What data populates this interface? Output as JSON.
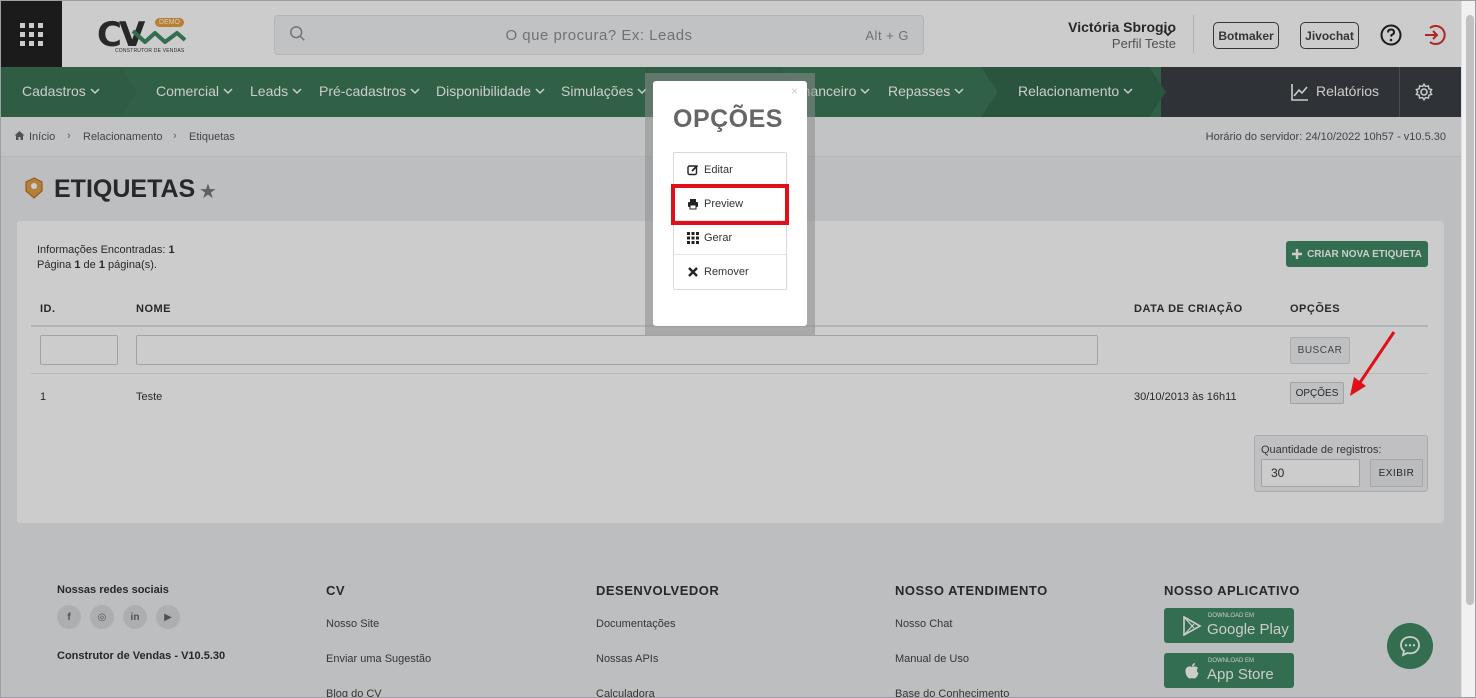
{
  "header": {
    "logo_text": "CV",
    "logo_badge": "DEMO",
    "logo_sub": "CONSTRUTOR DE VENDAS",
    "search_placeholder": "O que procura? Ex: Leads",
    "search_shortcut": "Alt + G",
    "user_name": "Victória Sbrogio",
    "user_profile": "Perfil Teste",
    "btn_botmaker": "Botmaker",
    "btn_jivochat": "Jivochat"
  },
  "nav": {
    "items": [
      "Cadastros",
      "Comercial",
      "Leads",
      "Pré-cadastros",
      "Disponibilidade",
      "Simulações",
      "Financeiro",
      "Repasses",
      "Relacionamento"
    ],
    "relatorios": "Relatórios",
    "colors": {
      "green": "#3d7a59",
      "dark": "#3b3f44"
    }
  },
  "breadcrumb": {
    "items": [
      "Início",
      "Relacionamento",
      "Etiquetas"
    ],
    "server_time": "Horário do servidor: 24/10/2022 10h57 - v10.5.30"
  },
  "page": {
    "title": "ETIQUETAS",
    "info_label": "Informações Encontradas:",
    "info_count": "1",
    "page_text_1": "Página",
    "page_current": "1",
    "page_text_2": "de",
    "page_total": "1",
    "page_text_3": "página(s).",
    "new_button": "CRIAR NOVA ETIQUETA",
    "columns": [
      "ID.",
      "NOME",
      "DATA DE CRIAÇÃO",
      "OPÇÕES"
    ],
    "search_button": "BUSCAR",
    "rows": [
      {
        "id": "1",
        "name": "Teste",
        "created": "30/10/2013 às 16h11",
        "options": "OPÇÕES"
      }
    ],
    "qty_label": "Quantidade de registros:",
    "qty_value": "30",
    "qty_button": "EXIBIR"
  },
  "footer": {
    "social_title": "Nossas redes sociais",
    "version": "Construtor de Vendas - V10.5.30",
    "cols": [
      {
        "title": "CV",
        "links": [
          "Nosso Site",
          "Enviar uma Sugestão",
          "Blog do CV"
        ]
      },
      {
        "title": "DESENVOLVEDOR",
        "links": [
          "Documentações",
          "Nossas APIs",
          "Calculadora"
        ]
      },
      {
        "title": "NOSSO ATENDIMENTO",
        "links": [
          "Nosso Chat",
          "Manual de Uso",
          "Base do Conhecimento"
        ]
      }
    ],
    "app_title": "NOSSO APLICATIVO",
    "google_small": "DOWNLOAD EM",
    "google_big": "Google Play",
    "apple_small": "DOWNLOAD EM",
    "apple_big": "App Store"
  },
  "modal": {
    "title": "OPÇÕES",
    "close": "×",
    "items": [
      "Editar",
      "Preview",
      "Gerar",
      "Remover"
    ],
    "highlight_color": "#e0101a"
  }
}
